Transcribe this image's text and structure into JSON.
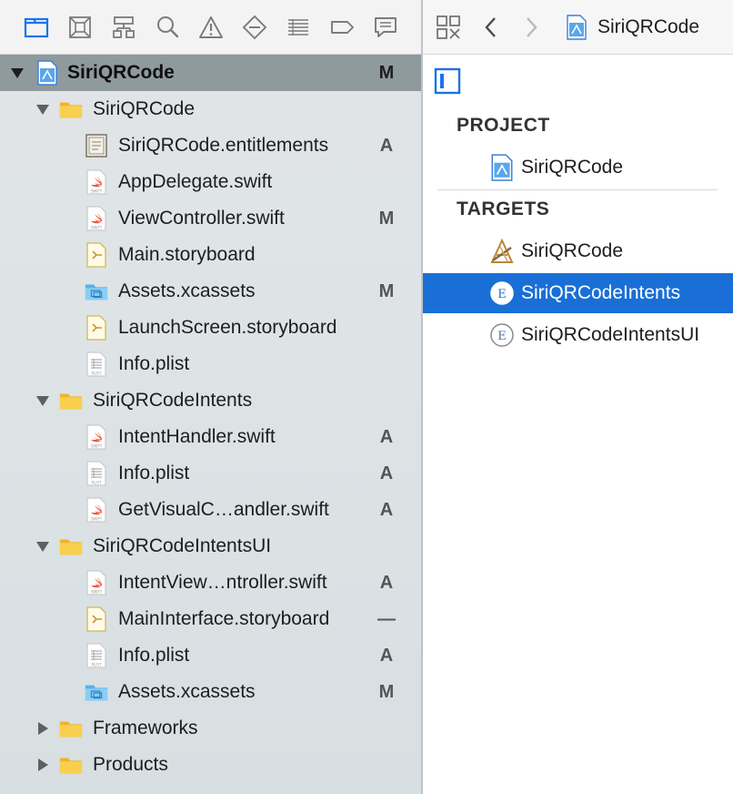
{
  "navigator": {
    "toolbar_icons": [
      "folder-icon",
      "source-control-icon",
      "symbol-hierarchy-icon",
      "search-icon",
      "warning-icon",
      "breakpoint-icon",
      "report-list-icon",
      "tag-icon",
      "comment-icon"
    ],
    "tree": [
      {
        "label": "SiriQRCode",
        "icon": "project-icon",
        "level": 0,
        "disclosure": "open",
        "status": "M",
        "root": true
      },
      {
        "label": "SiriQRCode",
        "icon": "folder-icon",
        "level": 1,
        "disclosure": "open",
        "status": ""
      },
      {
        "label": "SiriQRCode.entitlements",
        "icon": "entitlements-icon",
        "level": 2,
        "status": "A"
      },
      {
        "label": "AppDelegate.swift",
        "icon": "swift-file-icon",
        "level": 2,
        "status": ""
      },
      {
        "label": "ViewController.swift",
        "icon": "swift-file-icon",
        "level": 2,
        "status": "M"
      },
      {
        "label": "Main.storyboard",
        "icon": "storyboard-icon",
        "level": 2,
        "status": ""
      },
      {
        "label": "Assets.xcassets",
        "icon": "asset-catalog-icon",
        "level": 2,
        "status": "M"
      },
      {
        "label": "LaunchScreen.storyboard",
        "icon": "storyboard-icon",
        "level": 2,
        "status": ""
      },
      {
        "label": "Info.plist",
        "icon": "plist-icon",
        "level": 2,
        "status": ""
      },
      {
        "label": "SiriQRCodeIntents",
        "icon": "folder-icon",
        "level": 1,
        "disclosure": "open",
        "status": ""
      },
      {
        "label": "IntentHandler.swift",
        "icon": "swift-file-icon",
        "level": 2,
        "status": "A"
      },
      {
        "label": "Info.plist",
        "icon": "plist-icon",
        "level": 2,
        "status": "A"
      },
      {
        "label": "GetVisualC…andler.swift",
        "icon": "swift-file-icon",
        "level": 2,
        "status": "A"
      },
      {
        "label": "SiriQRCodeIntentsUI",
        "icon": "folder-icon",
        "level": 1,
        "disclosure": "open",
        "status": ""
      },
      {
        "label": "IntentView…ntroller.swift",
        "icon": "swift-file-icon",
        "level": 2,
        "status": "A"
      },
      {
        "label": "MainInterface.storyboard",
        "icon": "storyboard-icon",
        "level": 2,
        "status": "—"
      },
      {
        "label": "Info.plist",
        "icon": "plist-icon",
        "level": 2,
        "status": "A"
      },
      {
        "label": "Assets.xcassets",
        "icon": "asset-catalog-icon",
        "level": 2,
        "status": "M"
      },
      {
        "label": "Frameworks",
        "icon": "folder-icon",
        "level": 1,
        "disclosure": "closed",
        "status": ""
      },
      {
        "label": "Products",
        "icon": "folder-icon",
        "level": 1,
        "disclosure": "closed",
        "status": ""
      }
    ]
  },
  "editor": {
    "jump_bar": {
      "title": "SiriQRCode"
    },
    "project_header": "PROJECT",
    "project_items": [
      {
        "label": "SiriQRCode",
        "icon": "project-icon"
      }
    ],
    "targets_header": "TARGETS",
    "target_items": [
      {
        "label": "SiriQRCode",
        "icon": "app-target-icon",
        "selected": false
      },
      {
        "label": "SiriQRCodeIntents",
        "icon": "extension-target-icon",
        "selected": true
      },
      {
        "label": "SiriQRCodeIntentsUI",
        "icon": "extension-target-icon",
        "selected": false
      }
    ]
  },
  "colors": {
    "selection": "#1a6fd6",
    "accent": "#1a73e8",
    "swift": "#f05138",
    "folder": "#f7c844"
  }
}
